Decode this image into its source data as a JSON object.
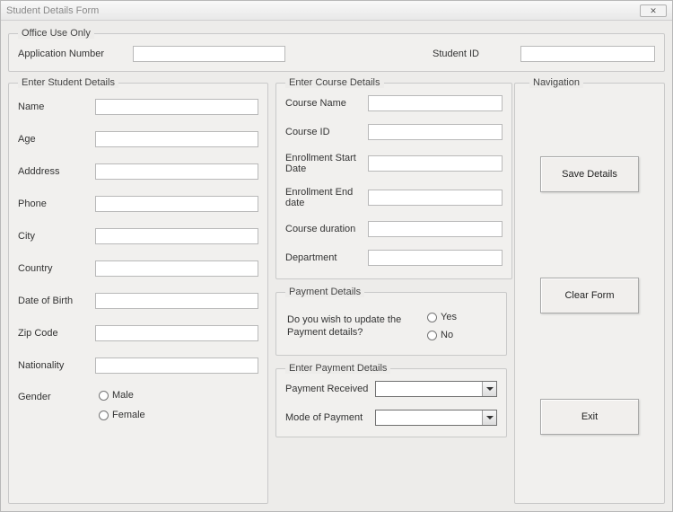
{
  "window": {
    "title": "Student Details Form"
  },
  "office": {
    "legend": "Office Use Only",
    "app_number_label": "Application Number",
    "app_number_value": "",
    "student_id_label": "Student ID",
    "student_id_value": ""
  },
  "student": {
    "legend": "Enter Student Details",
    "name_label": "Name",
    "name_value": "",
    "age_label": "Age",
    "age_value": "",
    "address_label": "Adddress",
    "address_value": "",
    "phone_label": "Phone",
    "phone_value": "",
    "city_label": "City",
    "city_value": "",
    "country_label": "Country",
    "country_value": "",
    "dob_label": "Date of Birth",
    "dob_value": "",
    "zip_label": "Zip Code",
    "zip_value": "",
    "nationality_label": "Nationality",
    "nationality_value": "",
    "gender_label": "Gender",
    "gender_male": "Male",
    "gender_female": "Female"
  },
  "course": {
    "legend": "Enter Course Details",
    "name_label": "Course Name",
    "name_value": "",
    "id_label": "Course ID",
    "id_value": "",
    "enroll_start_label": "Enrollment Start Date",
    "enroll_start_value": "",
    "enroll_end_label": "Enrollment End date",
    "enroll_end_value": "",
    "duration_label": "Course duration",
    "duration_value": "",
    "department_label": "Department",
    "department_value": ""
  },
  "payment_q": {
    "legend": "Payment Details",
    "question": "Do you wish to update the Payment details?",
    "yes": "Yes",
    "no": "No"
  },
  "payment_details": {
    "legend": "Enter Payment Details",
    "received_label": "Payment Received",
    "received_value": "",
    "mode_label": "Mode of Payment",
    "mode_value": ""
  },
  "nav": {
    "legend": "Navigation",
    "save": "Save Details",
    "clear": "Clear Form",
    "exit": "Exit"
  }
}
